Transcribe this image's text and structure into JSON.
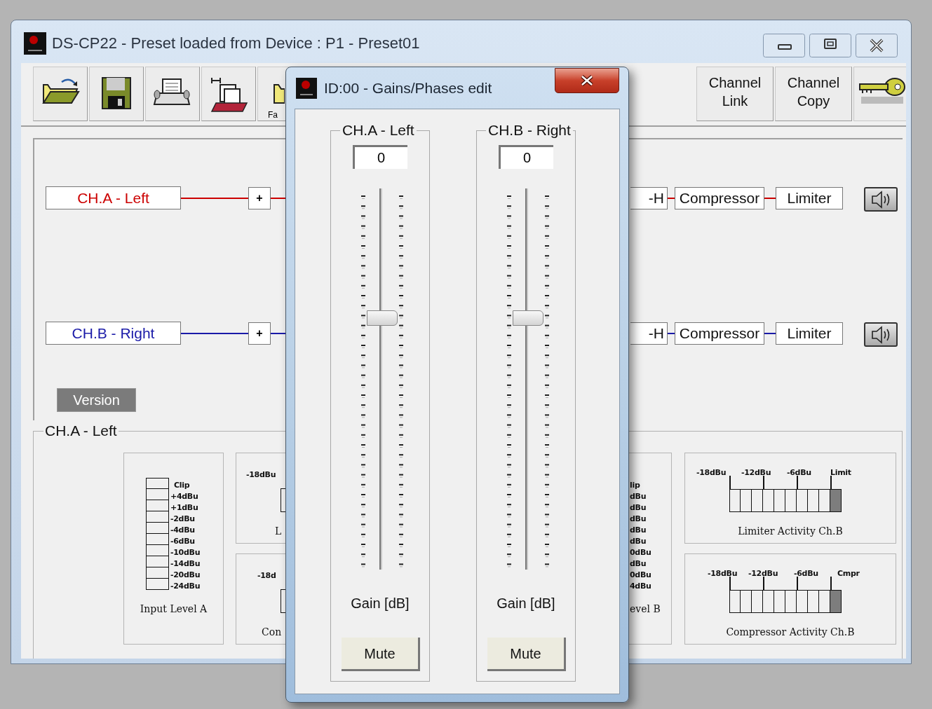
{
  "main_window": {
    "title": "DS-CP22 - Preset loaded from Device : P1 - Preset01"
  },
  "toolbar": {
    "left": [
      {
        "kind": "open"
      },
      {
        "kind": "save"
      },
      {
        "kind": "print"
      },
      {
        "kind": "export"
      },
      {
        "kind": "partial",
        "label": "Fa"
      }
    ],
    "right": [
      {
        "kind": "text",
        "label": "Channel Link"
      },
      {
        "kind": "text",
        "label": "Channel Copy"
      },
      {
        "kind": "key"
      }
    ]
  },
  "routing": {
    "channels": [
      {
        "name": "CH.A - Left",
        "color": "#cc0000",
        "mix": "+",
        "stages": [
          "-H",
          "Compressor",
          "Limiter"
        ]
      },
      {
        "name": "CH.B - Right",
        "color": "#1a1aa8",
        "mix": "+",
        "stages": [
          "-H",
          "Compressor",
          "Limiter"
        ]
      }
    ],
    "version_button": "Version"
  },
  "detail_group": {
    "title": "CH.A - Left",
    "input_meter": {
      "labels": [
        "Clip",
        "+4dBu",
        "+1dBu",
        "-2dBu",
        "-4dBu",
        "-6dBu",
        "-10dBu",
        "-14dBu",
        "-20dBu",
        "-24dBu"
      ],
      "caption": "Input Level A"
    },
    "left_partial_panels": [
      {
        "tick": "-18dBu",
        "caption": "L"
      },
      {
        "tick": "-18d",
        "caption": "Con"
      }
    ],
    "right_partial_panel": {
      "labels": [
        "lip",
        "dBu",
        "dBu",
        "dBu",
        "dBu",
        "dBu",
        "0dBu",
        "dBu",
        "0dBu",
        "4dBu"
      ],
      "caption": "evel B"
    },
    "activity_meters": [
      {
        "ticks": [
          "-18dBu",
          "-12dBu",
          "-6dBu",
          "Limit"
        ],
        "caption": "Limiter Activity Ch.B",
        "active": true
      },
      {
        "ticks": [
          "-18dBu",
          "-12dBu",
          "-6dBu",
          "Cmpr"
        ],
        "caption": "Compressor Activity Ch.B",
        "active": true
      }
    ]
  },
  "dialog": {
    "title": "ID:00 - Gains/Phases edit",
    "channels": [
      {
        "name": "CH.A - Left",
        "value": "0",
        "level": 0.66,
        "gain_label": "Gain [dB]",
        "mute": "Mute"
      },
      {
        "name": "CH.B - Right",
        "value": "0",
        "level": 0.66,
        "gain_label": "Gain [dB]",
        "mute": "Mute"
      }
    ]
  }
}
